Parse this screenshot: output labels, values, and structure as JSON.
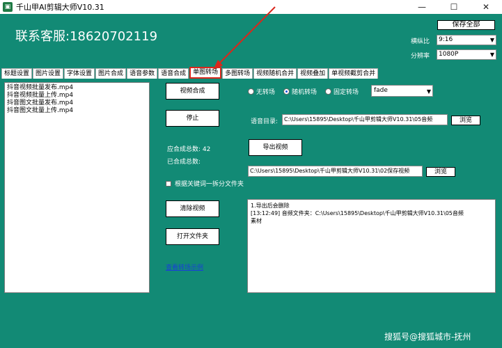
{
  "window": {
    "title": "千山甲AI剪辑大师V10.31",
    "minimize": "—",
    "maximize": "☐",
    "close": "✕"
  },
  "header": {
    "support": "联系客服:18620702119",
    "save_all": "保存全部",
    "ratio_label": "横纵比",
    "ratio_value": "9:16",
    "resolution_label": "分辨率",
    "resolution_value": "1080P"
  },
  "tabs": [
    {
      "label": "标题设置"
    },
    {
      "label": "图片设置"
    },
    {
      "label": "字体设置"
    },
    {
      "label": "图片合成"
    },
    {
      "label": "语音参数"
    },
    {
      "label": "语音合成"
    },
    {
      "label": "单图转场",
      "active": true
    },
    {
      "label": "多图转场"
    },
    {
      "label": "视频随机合并"
    },
    {
      "label": "视频叠加"
    },
    {
      "label": "单视频截剪合并"
    }
  ],
  "files": [
    "抖音视频批量发布.mp4",
    "抖音视频批量上传.mp4",
    "抖音图文批量发布.mp4",
    "抖音图文批量上传.mp4"
  ],
  "buttons": {
    "compose": "视频合成",
    "stop": "停止",
    "clear": "清除视频",
    "open_folder": "打开文件夹",
    "export": "导出视频",
    "browse1": "浏览",
    "browse2": "浏览"
  },
  "transition": {
    "none": "无转场",
    "random": "随机转场",
    "fixed": "固定转场",
    "effect": "fade"
  },
  "audio": {
    "label": "语音目录:",
    "path": "C:\\Users\\15895\\Desktop\\千山甲剪辑大师V10.31\\05音频"
  },
  "stats": {
    "total": "应合成总数: 42",
    "done": "已合成总数:"
  },
  "output_path": "C:\\Users\\15895\\Desktop\\千山甲剪辑大师V10.31\\02保存视频",
  "split_checkbox": "根据关键词一拆分文件夹",
  "demo_link": "查看转场示例",
  "log": [
    "1.导出后会删除",
    "[13:12:49] 音频文件夹：C:\\Users\\15895\\Desktop\\千山甲剪辑大师V10.31\\05音频",
    "素材"
  ],
  "watermark": "搜狐号@搜狐城市-抚州"
}
